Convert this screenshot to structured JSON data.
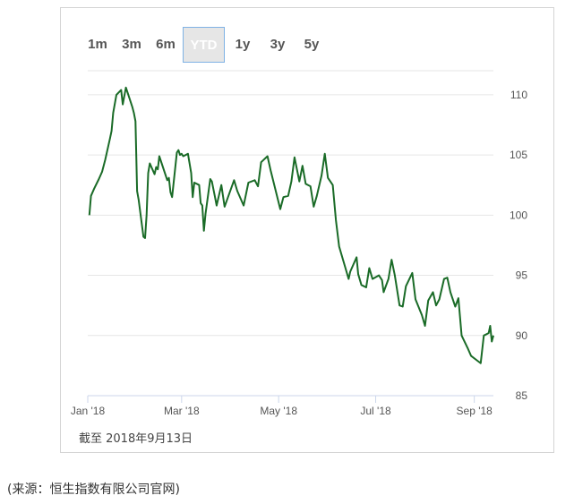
{
  "range_selector": {
    "buttons": [
      "1m",
      "3m",
      "6m",
      "YTD",
      "1y",
      "3y",
      "5y"
    ],
    "active": "YTD"
  },
  "as_of_label": "截至 2018年9月13日",
  "source_label": "(来源：恒生指数有限公司官网)",
  "colors": {
    "line": "#1a6b27",
    "grid": "#e6e6e6",
    "axis": "#ccd6eb",
    "active_border": "#7fb2e5"
  },
  "chart_data": {
    "type": "line",
    "title": "",
    "xlabel": "",
    "ylabel": "",
    "ylim": [
      85,
      112
    ],
    "yticks": [
      85,
      90,
      95,
      100,
      105,
      110
    ],
    "xticks": [
      {
        "label": "Jan '18",
        "x": "2018-01-01"
      },
      {
        "label": "Mar '18",
        "x": "2018-03-01"
      },
      {
        "label": "May '18",
        "x": "2018-05-01"
      },
      {
        "label": "Jul '18",
        "x": "2018-07-01"
      },
      {
        "label": "Sep '18",
        "x": "2018-09-01"
      }
    ],
    "grid": true,
    "series": [
      {
        "name": "",
        "x": [
          "2018-01-02",
          "2018-01-03",
          "2018-01-05",
          "2018-01-08",
          "2018-01-10",
          "2018-01-12",
          "2018-01-15",
          "2018-01-16",
          "2018-01-17",
          "2018-01-19",
          "2018-01-22",
          "2018-01-23",
          "2018-01-25",
          "2018-01-26",
          "2018-01-29",
          "2018-01-30",
          "2018-01-31",
          "2018-02-01",
          "2018-02-02",
          "2018-02-05",
          "2018-02-06",
          "2018-02-07",
          "2018-02-08",
          "2018-02-09",
          "2018-02-12",
          "2018-02-13",
          "2018-02-14",
          "2018-02-15",
          "2018-02-20",
          "2018-02-21",
          "2018-02-22",
          "2018-02-23",
          "2018-02-26",
          "2018-02-27",
          "2018-02-28",
          "2018-03-01",
          "2018-03-02",
          "2018-03-05",
          "2018-03-07",
          "2018-03-08",
          "2018-03-09",
          "2018-03-12",
          "2018-03-13",
          "2018-03-14",
          "2018-03-15",
          "2018-03-16",
          "2018-03-19",
          "2018-03-20",
          "2018-03-22",
          "2018-03-23",
          "2018-03-26",
          "2018-03-28",
          "2018-04-03",
          "2018-04-05",
          "2018-04-09",
          "2018-04-12",
          "2018-04-16",
          "2018-04-18",
          "2018-04-20",
          "2018-04-24",
          "2018-04-26",
          "2018-05-02",
          "2018-05-04",
          "2018-05-07",
          "2018-05-09",
          "2018-05-11",
          "2018-05-14",
          "2018-05-16",
          "2018-05-18",
          "2018-05-21",
          "2018-05-23",
          "2018-05-25",
          "2018-05-28",
          "2018-05-30",
          "2018-06-01",
          "2018-06-04",
          "2018-06-06",
          "2018-06-08",
          "2018-06-12",
          "2018-06-14",
          "2018-06-15",
          "2018-06-19",
          "2018-06-20",
          "2018-06-22",
          "2018-06-25",
          "2018-06-27",
          "2018-06-29",
          "2018-07-03",
          "2018-07-05",
          "2018-07-06",
          "2018-07-09",
          "2018-07-11",
          "2018-07-13",
          "2018-07-16",
          "2018-07-18",
          "2018-07-20",
          "2018-07-24",
          "2018-07-26",
          "2018-07-30",
          "2018-08-01",
          "2018-08-03",
          "2018-08-06",
          "2018-08-08",
          "2018-08-10",
          "2018-08-13",
          "2018-08-15",
          "2018-08-17",
          "2018-08-20",
          "2018-08-22",
          "2018-08-24",
          "2018-08-28",
          "2018-08-30",
          "2018-09-03",
          "2018-09-05",
          "2018-09-07",
          "2018-09-10",
          "2018-09-11",
          "2018-09-12",
          "2018-09-13"
        ],
        "values": [
          100.0,
          101.6,
          102.2,
          103.0,
          103.6,
          104.6,
          106.4,
          107.0,
          108.5,
          110.0,
          110.4,
          109.2,
          110.6,
          110.2,
          109.0,
          108.5,
          107.8,
          102.0,
          101.3,
          98.2,
          98.1,
          100.0,
          103.5,
          104.3,
          103.4,
          104.0,
          103.8,
          104.9,
          102.9,
          103.1,
          101.9,
          101.5,
          105.2,
          105.4,
          105.0,
          105.1,
          104.9,
          105.1,
          103.5,
          101.5,
          102.7,
          102.5,
          101.0,
          100.8,
          98.7,
          100.1,
          103.0,
          102.8,
          101.5,
          100.8,
          102.5,
          100.7,
          102.9,
          102.0,
          100.8,
          102.7,
          102.9,
          102.4,
          104.4,
          104.9,
          103.7,
          100.5,
          101.5,
          101.6,
          102.8,
          104.8,
          102.8,
          104.1,
          102.6,
          102.4,
          100.7,
          101.6,
          103.3,
          105.1,
          103.1,
          102.5,
          99.6,
          97.4,
          95.6,
          94.7,
          95.3,
          96.5,
          95.1,
          94.2,
          94.0,
          95.6,
          94.7,
          95.0,
          94.6,
          93.6,
          94.7,
          96.3,
          95.0,
          92.5,
          92.4,
          94.1,
          95.2,
          93.0,
          91.7,
          90.8,
          92.9,
          93.6,
          92.5,
          93.0,
          94.7,
          94.8,
          93.6,
          92.4,
          93.1,
          90.0,
          88.9,
          88.3,
          87.9,
          87.7,
          90.0,
          90.2,
          90.8,
          89.5,
          90.0
        ]
      }
    ]
  }
}
